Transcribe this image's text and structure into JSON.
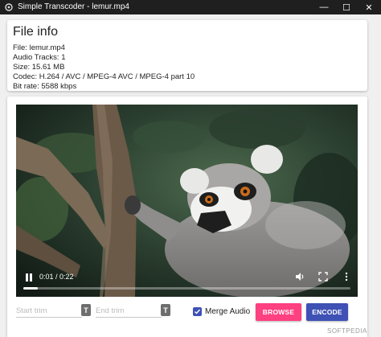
{
  "window": {
    "title": "Simple Transcoder - lemur.mp4",
    "controls": {
      "minimize": "—",
      "maximize": "☐",
      "close": "✕"
    }
  },
  "file_info": {
    "heading": "File info",
    "lines": [
      "File: lemur.mp4",
      "Audio Tracks: 1",
      "Size: 15.61 MB",
      "Codec: H.264 / AVC / MPEG-4 AVC / MPEG-4 part 10",
      "Bit rate: 5588 kbps"
    ]
  },
  "player": {
    "time": "0:01 / 0:22",
    "progress_fraction": 0.045,
    "icons": [
      "pause-icon",
      "volume-icon",
      "fullscreen-icon",
      "more-options-icon"
    ]
  },
  "trim": {
    "start_placeholder": "Start trim",
    "end_placeholder": "End trim",
    "button_label": "T"
  },
  "merge_audio": {
    "label": "Merge Audio",
    "checked": true
  },
  "buttons": {
    "browse": "BROWSE",
    "encode": "ENCODE"
  },
  "colors": {
    "accent_pink": "#ff4081",
    "accent_indigo": "#3f51b5"
  },
  "watermark": "SOFTPEDIA"
}
